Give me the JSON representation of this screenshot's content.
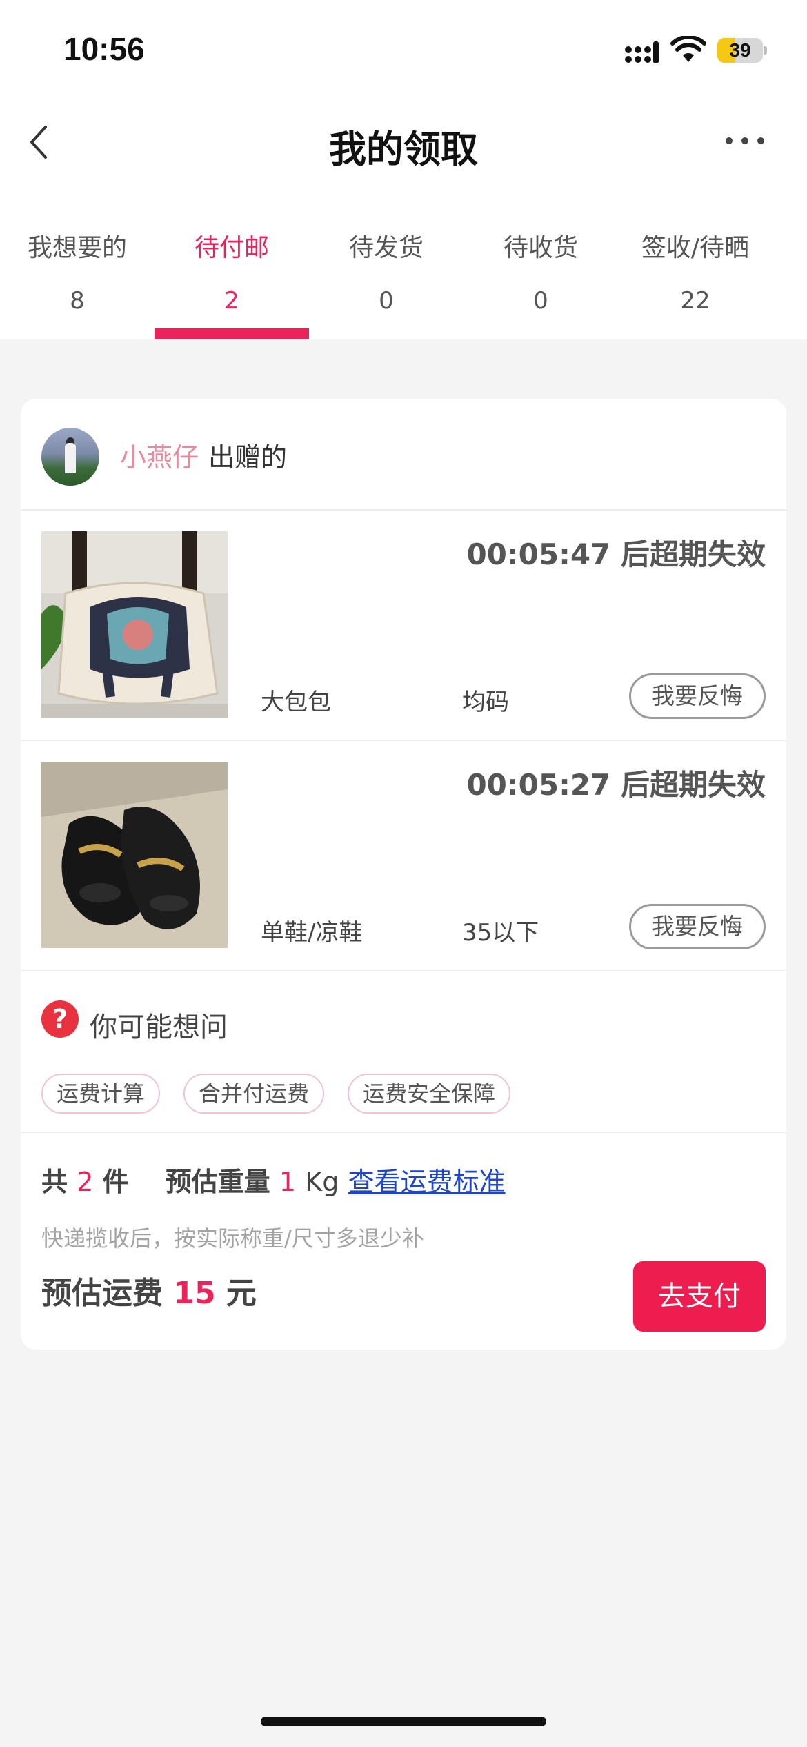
{
  "status_bar": {
    "time": "10:56",
    "battery": "39",
    "battery_level": 0.39
  },
  "nav": {
    "title": "我的领取"
  },
  "tabs": [
    {
      "label": "我想要的",
      "count": "8"
    },
    {
      "label": "待付邮",
      "count": "2"
    },
    {
      "label": "待发货",
      "count": "0"
    },
    {
      "label": "待收货",
      "count": "0"
    },
    {
      "label": "签收/待晒",
      "count": "22"
    }
  ],
  "active_tab": "待付邮",
  "giver": {
    "name": "小燕仔",
    "suffix": "出赠的"
  },
  "items": [
    {
      "countdown": "00:05:47 后超期失效",
      "category": "大包包",
      "size": "均码",
      "action": "我要反悔"
    },
    {
      "countdown": "00:05:27 后超期失效",
      "category": "单鞋/凉鞋",
      "size": "35以下",
      "action": "我要反悔"
    }
  ],
  "faq": {
    "title": "你可能想问",
    "chips": [
      "运费计算",
      "合并付运费",
      "运费安全保障"
    ]
  },
  "summary": {
    "total_prefix": "共",
    "total_count": "2",
    "total_suffix": "件",
    "weight_label": "预估重量",
    "weight_value": "1",
    "weight_unit": "Kg",
    "fee_standard_link": "查看运费标准",
    "note": "快递揽收后，按实际称重/尺寸多退少补",
    "fee_label": "预估运费",
    "fee_value": "15",
    "fee_unit": "元",
    "pay_button": "去支付"
  },
  "colors": {
    "accent": "#e8245a",
    "pay_button": "#ee1d4f",
    "link": "#2046c8"
  }
}
